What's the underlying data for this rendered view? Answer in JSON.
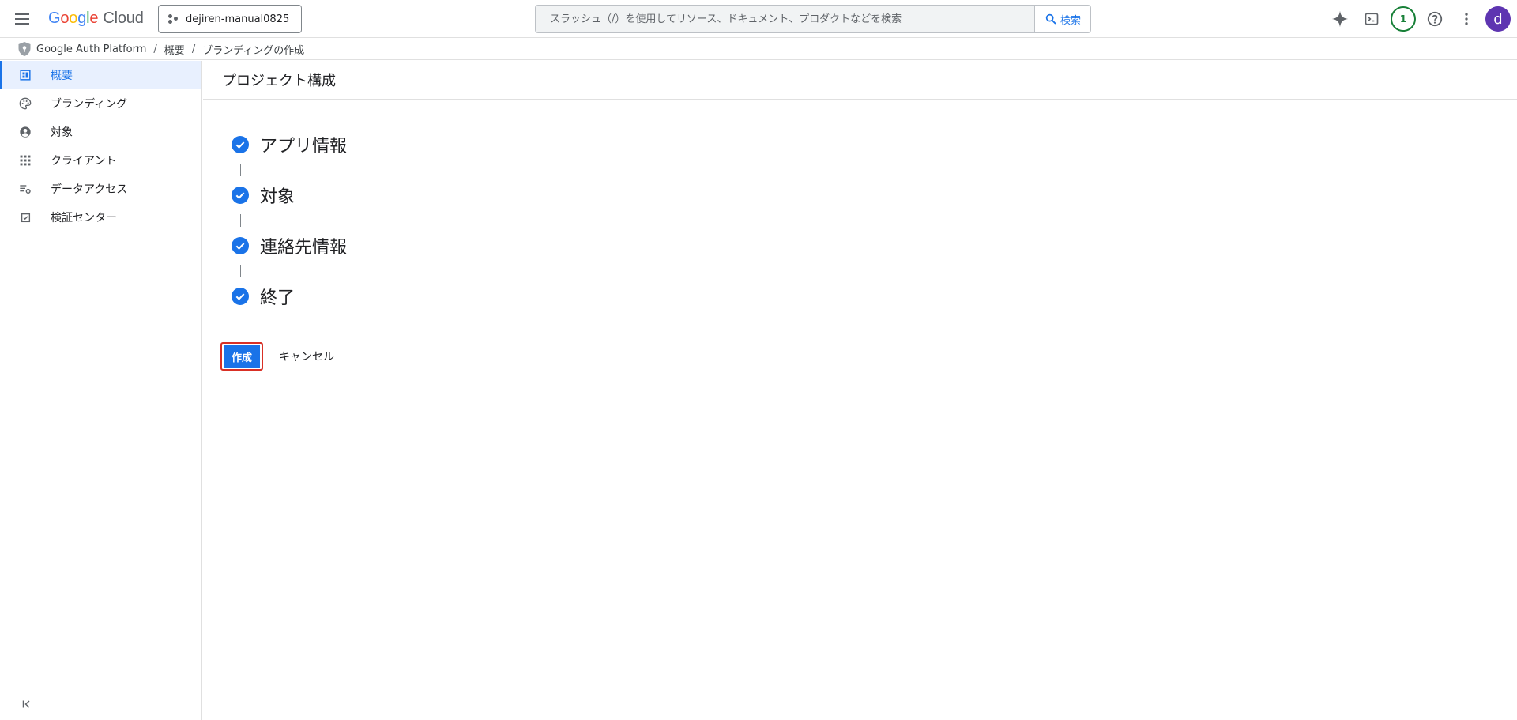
{
  "header": {
    "logo_google": [
      "G",
      "o",
      "o",
      "g",
      "l",
      "e"
    ],
    "logo_cloud": "Cloud",
    "project_name": "dejiren-manual0825",
    "search_placeholder": "スラッシュ（/）を使用してリソース、ドキュメント、プロダクトなどを検索",
    "search_button": "検索",
    "notification_count": "1",
    "avatar_letter": "d"
  },
  "breadcrumb": {
    "items": [
      "Google Auth Platform",
      "概要",
      "ブランディングの作成"
    ],
    "separator": "/"
  },
  "sidebar": {
    "items": [
      {
        "label": "概要",
        "icon": "dashboard-icon",
        "active": true
      },
      {
        "label": "ブランディング",
        "icon": "palette-icon",
        "active": false
      },
      {
        "label": "対象",
        "icon": "account-circle-icon",
        "active": false
      },
      {
        "label": "クライアント",
        "icon": "apps-grid-icon",
        "active": false
      },
      {
        "label": "データアクセス",
        "icon": "data-settings-icon",
        "active": false
      },
      {
        "label": "検証センター",
        "icon": "checklist-icon",
        "active": false
      }
    ],
    "collapse_icon": "collapse-left-icon"
  },
  "main": {
    "title": "プロジェクト構成",
    "steps": [
      {
        "label": "アプリ情報",
        "done": true
      },
      {
        "label": "対象",
        "done": true
      },
      {
        "label": "連絡先情報",
        "done": true
      },
      {
        "label": "終了",
        "done": true
      }
    ],
    "create_button": "作成",
    "cancel_button": "キャンセル"
  },
  "colors": {
    "accent": "#1a73e8",
    "avatar": "#5e35b1",
    "badge": "#188038",
    "highlight_border": "#d93025"
  }
}
